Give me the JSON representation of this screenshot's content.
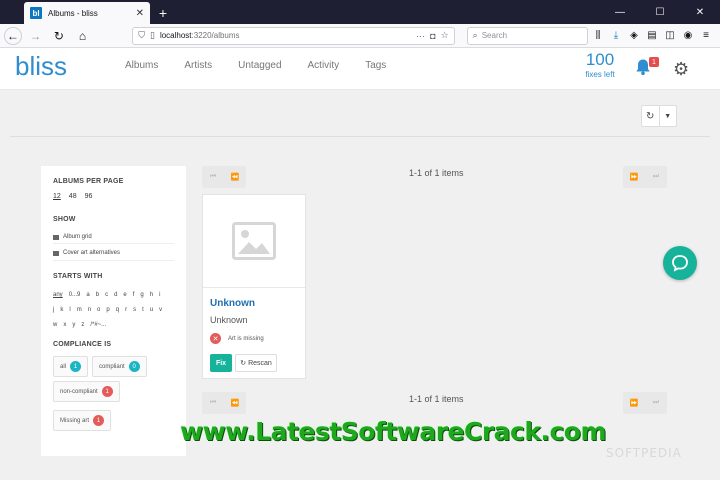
{
  "browser": {
    "tab_title": "Albums - bliss",
    "favicon_text": "bl",
    "url_host": "localhost",
    "url_path": ":3220/albums",
    "search_placeholder": "Search"
  },
  "app": {
    "logo": "bliss",
    "nav": [
      "Albums",
      "Artists",
      "Untagged",
      "Activity",
      "Tags"
    ],
    "fixes_count": "100",
    "fixes_label": "fixes left",
    "notification_count": "1"
  },
  "sidebar": {
    "albums_per_page_heading": "ALBUMS PER PAGE",
    "per_page_options": [
      "12",
      "48",
      "96"
    ],
    "show_heading": "SHOW",
    "show_options": [
      "Album grid",
      "Cover art alternatives"
    ],
    "starts_with_heading": "STARTS WITH",
    "letters_row1": [
      "any",
      "0...9",
      "a",
      "b",
      "c",
      "d",
      "e",
      "f",
      "g",
      "h",
      "i"
    ],
    "letters_row2": [
      "j",
      "k",
      "l",
      "m",
      "n",
      "o",
      "p",
      "q",
      "r",
      "s",
      "t",
      "u",
      "v"
    ],
    "letters_row3": [
      "w",
      "x",
      "y",
      "z",
      "/*#~..."
    ],
    "compliance_heading": "COMPLIANCE IS",
    "compliance_options": [
      {
        "label": "all",
        "count": "1"
      },
      {
        "label": "compliant",
        "count": "0"
      },
      {
        "label": "non-compliant",
        "count": "1"
      },
      {
        "label": "Missing art",
        "count": "1"
      }
    ]
  },
  "pagination": {
    "text": "1-1 of 1 items"
  },
  "album": {
    "title": "Unknown",
    "artist": "Unknown",
    "issue": "Art is missing",
    "fix_label": "Fix",
    "rescan_label": "Rescan"
  },
  "watermark": "www.LatestSoftwareCrack.com",
  "corner_watermark": "SOFTPEDIA",
  "colors": {
    "brand": "#2f8dd0",
    "fix": "#17b29a",
    "badge_red": "#e45b5b",
    "badge_teal": "#1ab5c2"
  }
}
